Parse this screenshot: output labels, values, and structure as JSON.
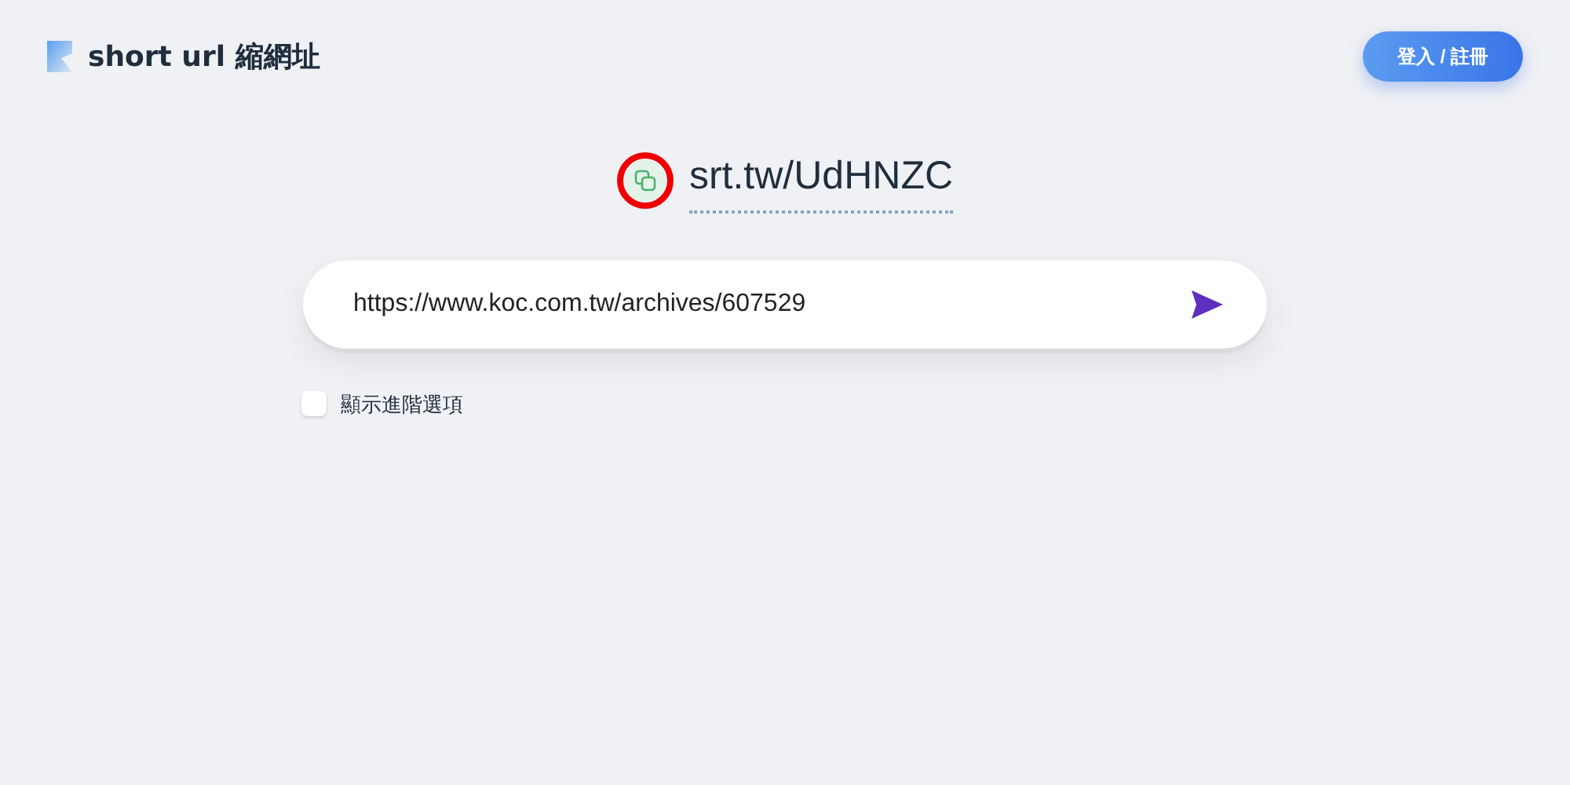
{
  "logo": {
    "text": "short url 縮網址"
  },
  "login_button": {
    "label": "登入 / 註冊"
  },
  "short_link": {
    "text": "srt.tw/UdHNZC",
    "highlighted": true
  },
  "url_field": {
    "value": "https://www.koc.com.tw/archives/607529"
  },
  "advanced_option": {
    "label": "顯示進階選項",
    "checked": false
  }
}
